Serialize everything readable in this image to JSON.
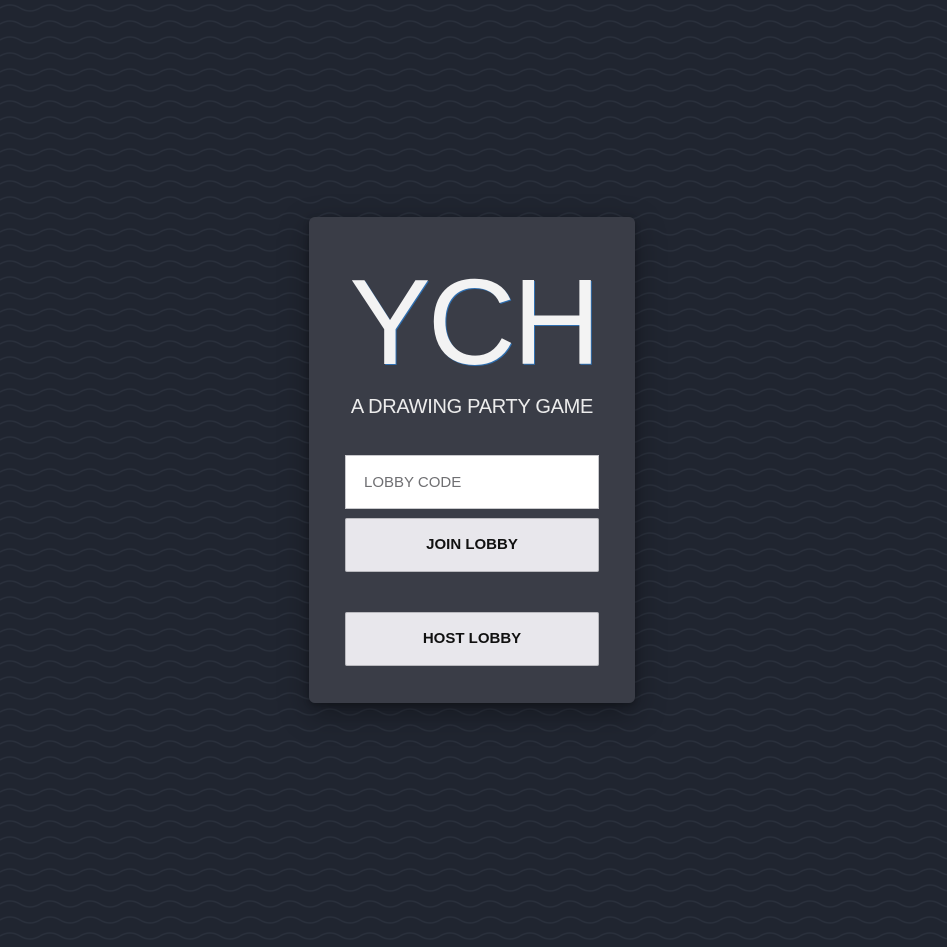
{
  "app": {
    "logo": "YCH",
    "tagline": "A DRAWING PARTY GAME"
  },
  "lobby_form": {
    "code_input": {
      "placeholder": "LOBBY CODE",
      "value": ""
    },
    "join_label": "JOIN LOBBY",
    "host_label": "HOST LOBBY"
  },
  "colors": {
    "background": "#202530",
    "card": "#3a3d47",
    "button": "#e8e7ec",
    "text_light": "#f3f3f3"
  }
}
